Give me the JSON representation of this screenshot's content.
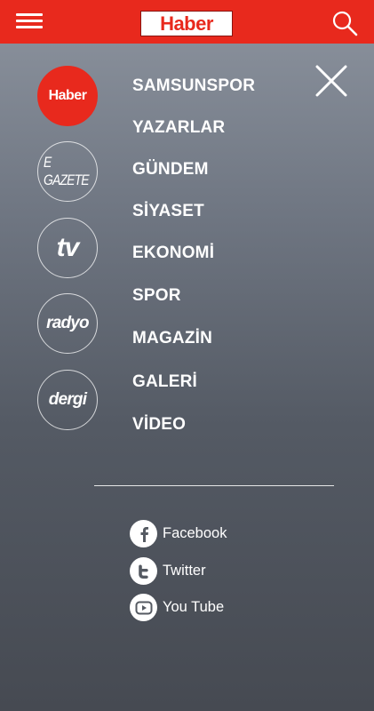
{
  "header": {
    "logo_text": "Haber"
  },
  "sections": [
    {
      "label": "Haber",
      "active": true
    },
    {
      "label": "E GAZETE",
      "active": false
    },
    {
      "label": "tv",
      "active": false
    },
    {
      "label": "radyo",
      "active": false
    },
    {
      "label": "dergi",
      "active": false
    }
  ],
  "menu": [
    "SAMSUNSPOR",
    "YAZARLAR",
    "GÜNDEM",
    "SİYASET",
    "EKONOMİ",
    "SPOR",
    "MAGAZİN",
    "GALERİ",
    "VİDEO"
  ],
  "social": [
    {
      "label": "Facebook",
      "icon": "facebook-icon"
    },
    {
      "label": "Twitter",
      "icon": "twitter-icon"
    },
    {
      "label": "You Tube",
      "icon": "youtube-icon"
    }
  ],
  "colors": {
    "brand_red": "#e8291d",
    "overlay_gray": "#6f7682"
  }
}
